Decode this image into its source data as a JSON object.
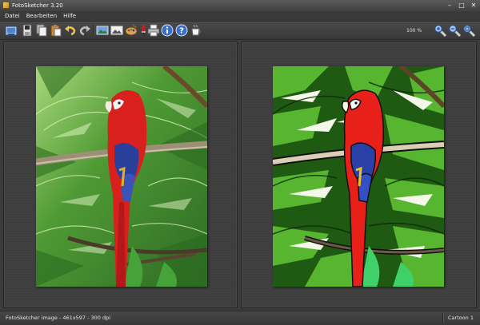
{
  "window": {
    "title": "FotoSketcher 3.20",
    "buttons": [
      "–",
      "□",
      "✕"
    ]
  },
  "menu": {
    "items": [
      "Datei",
      "Bearbeiten",
      "Hilfe"
    ]
  },
  "toolbar": {
    "icons": [
      "open-image-icon",
      "save-icon",
      "copy-icon",
      "paste-icon",
      "undo-icon",
      "redo-icon",
      "original-image-icon",
      "result-image-icon",
      "paint-palette-icon",
      "brush-icon",
      "print-icon",
      "info-icon",
      "help-icon",
      "coffee-cup-icon",
      "zoom-in-icon",
      "zoom-out-icon",
      "zoom-fit-icon"
    ],
    "zoom_level": "100 %"
  },
  "panels": {
    "original": {
      "subject": "scarlet-macaw-original"
    },
    "result": {
      "subject": "scarlet-macaw-cartoon"
    }
  },
  "status": {
    "info": "FotoSketcher image - 461x597 - 300 dpi",
    "effect": "Cartoon 1"
  },
  "colors": {
    "background": "#3c3c3c",
    "parrot_red": "#d8201c",
    "parrot_blue": "#2a3f9a",
    "foliage": "#3f9a2a"
  }
}
